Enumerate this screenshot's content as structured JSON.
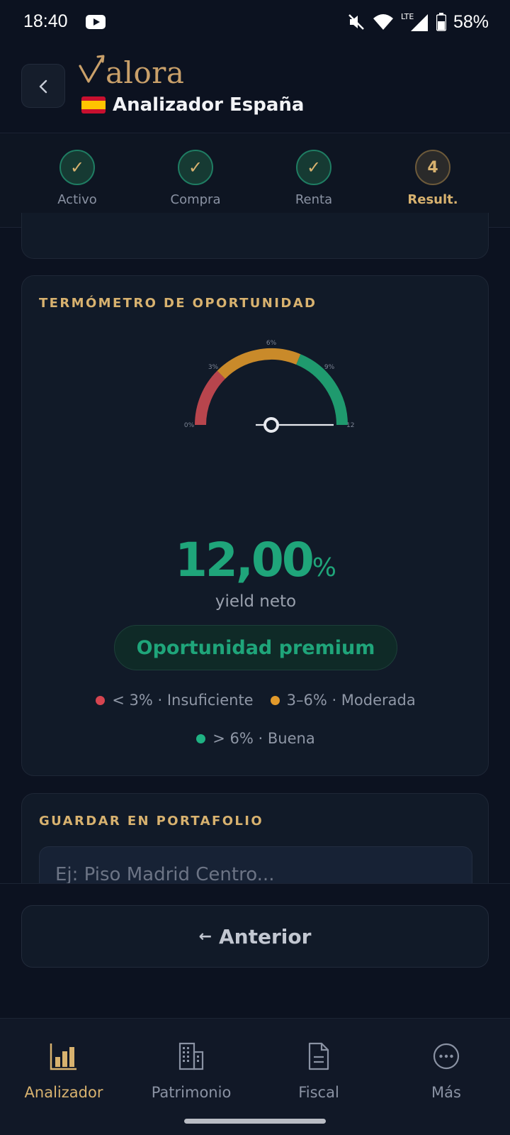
{
  "status_bar": {
    "time": "18:40",
    "network": "LTE",
    "battery": "58%"
  },
  "header": {
    "brand": "alora",
    "title": "Analizador España",
    "flag": "spain-flag"
  },
  "stepper": {
    "steps": [
      {
        "label": "Activo",
        "state": "done",
        "mark": "✓"
      },
      {
        "label": "Compra",
        "state": "done",
        "mark": "✓"
      },
      {
        "label": "Renta",
        "state": "done",
        "mark": "✓"
      },
      {
        "label": "Result.",
        "state": "current",
        "mark": "4"
      }
    ]
  },
  "thermometer": {
    "title": "TERMÓMETRO DE OPORTUNIDAD",
    "gauge": {
      "ticks": [
        "0%",
        "3%",
        "6%",
        "9%",
        "12%"
      ],
      "min": 0,
      "max": 12,
      "value": 12,
      "zones": [
        {
          "from": 0,
          "to": 3,
          "color": "#b8454d"
        },
        {
          "from": 3,
          "to": 7.5,
          "color": "#c98a2a"
        },
        {
          "from": 7.5,
          "to": 12,
          "color": "#1f9a6e"
        }
      ]
    },
    "value_number": "12,00",
    "value_unit": "%",
    "value_label": "yield neto",
    "verdict": "Oportunidad premium",
    "legend": [
      {
        "text": "< 3% · Insuficiente",
        "color": "#d64550"
      },
      {
        "text": "3–6% · Moderada",
        "color": "#e29a2b"
      },
      {
        "text": "> 6% · Buena",
        "color": "#1fb283"
      }
    ]
  },
  "portfolio": {
    "title": "GUARDAR EN PORTAFOLIO",
    "name_placeholder": "Ej: Piso Madrid Centro..."
  },
  "actions": {
    "previous_label": "Anterior",
    "previous_arrow": "←"
  },
  "bottom_nav": {
    "items": [
      {
        "label": "Analizador",
        "icon": "bar-chart-icon",
        "active": true
      },
      {
        "label": "Patrimonio",
        "icon": "building-icon",
        "active": false
      },
      {
        "label": "Fiscal",
        "icon": "document-icon",
        "active": false
      },
      {
        "label": "Más",
        "icon": "more-icon",
        "active": false
      }
    ]
  }
}
